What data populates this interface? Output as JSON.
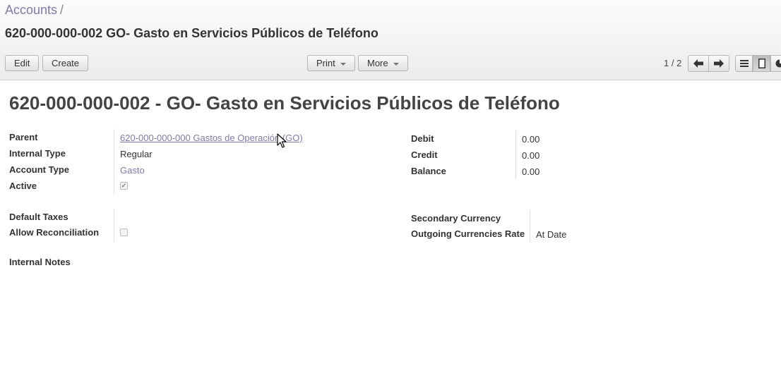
{
  "breadcrumb": {
    "parent": "Accounts",
    "separator": "/"
  },
  "header": {
    "record_title": "620-000-000-002 GO- Gasto en Servicios Públicos de Teléfono"
  },
  "toolbar": {
    "edit_label": "Edit",
    "create_label": "Create",
    "print_label": "Print",
    "more_label": "More"
  },
  "pager": {
    "value": "1 / 2"
  },
  "form": {
    "title": "620-000-000-002 - GO- Gasto en Servicios Públicos de Teléfono",
    "left": {
      "parent_label": "Parent",
      "parent_value": "620-000-000-000 Gastos de Operación (GO)",
      "internal_type_label": "Internal Type",
      "internal_type_value": "Regular",
      "account_type_label": "Account Type",
      "account_type_value": "Gasto",
      "active_label": "Active",
      "active_checked": true
    },
    "right": {
      "debit_label": "Debit",
      "debit_value": "0.00",
      "credit_label": "Credit",
      "credit_value": "0.00",
      "balance_label": "Balance",
      "balance_value": "0.00"
    },
    "left2": {
      "default_taxes_label": "Default Taxes",
      "default_taxes_value": "",
      "allow_reconciliation_label": "Allow Reconciliation",
      "allow_reconciliation_checked": false
    },
    "right2": {
      "secondary_currency_label": "Secondary Currency",
      "secondary_currency_value": "",
      "outgoing_rate_label": "Outgoing Currencies Rate",
      "outgoing_rate_value": "At Date"
    },
    "internal_notes_label": "Internal Notes"
  },
  "colors": {
    "link": "#7c7bad",
    "text": "#333333"
  }
}
